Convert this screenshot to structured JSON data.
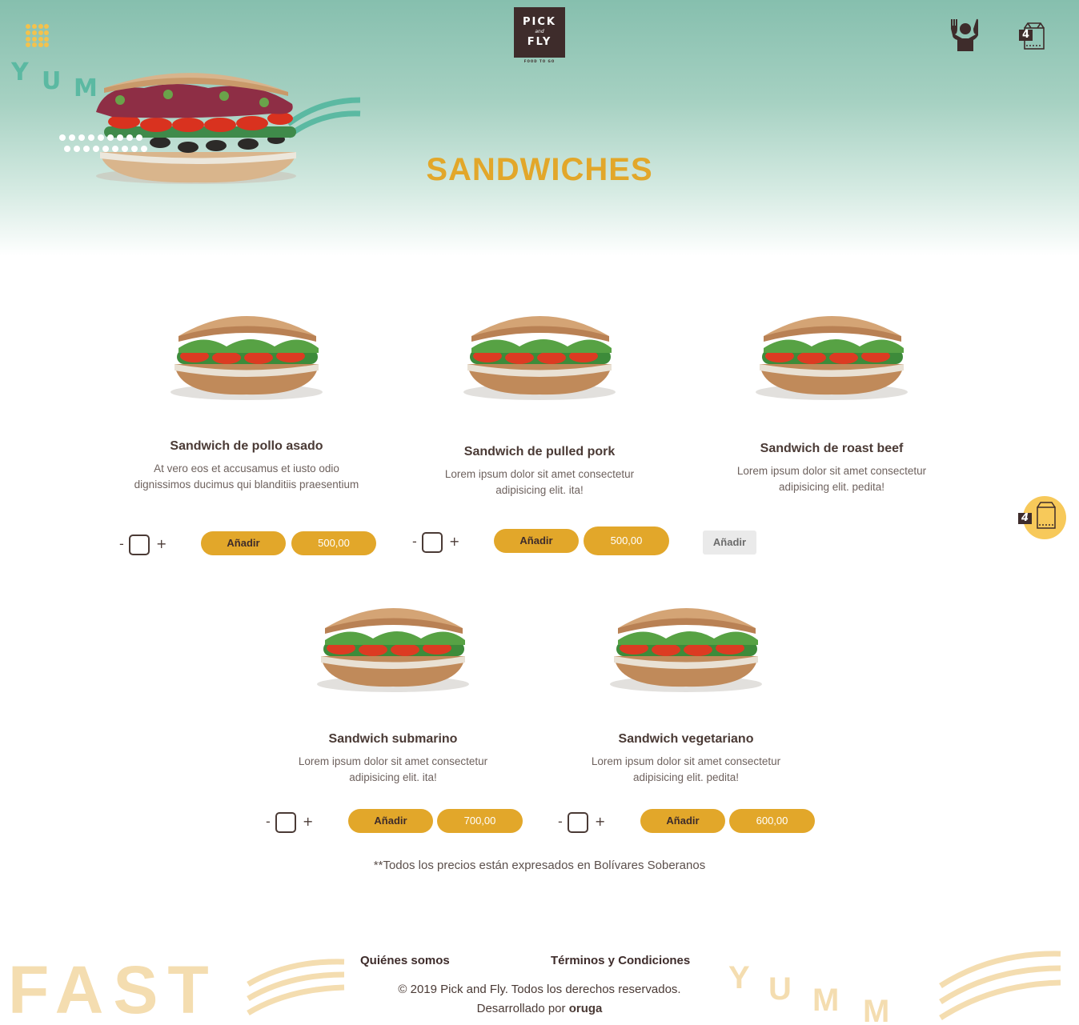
{
  "header": {
    "logo": {
      "line1": "PICK",
      "line2": "and",
      "line3": "FLY",
      "tagline": "FOOD TO GO"
    },
    "menu_icon": "grid-menu-icon",
    "user_icon": "user-icon",
    "cart_icon": "cart-bag-icon",
    "cart_count": "4",
    "hero_letters": [
      "Y",
      "U",
      "M"
    ]
  },
  "page_title": "SANDWICHES",
  "products": [
    {
      "name": "Sandwich de pollo asado",
      "description": "At vero eos et accusamus et iusto odio dignissimos ducimus qui blanditiis praesentium",
      "minus": "-",
      "plus": "+",
      "add_label": "Añadir",
      "price": "500,00"
    },
    {
      "name": "Sandwich de pulled pork",
      "description": "Lorem ipsum dolor sit amet consectetur adipisicing elit. ita!",
      "minus": "-",
      "plus": "+",
      "add_label": "Añadir",
      "price": "500,00"
    },
    {
      "name": "Sandwich de roast beef",
      "description": "Lorem ipsum dolor sit amet consectetur adipisicing elit. pedita!",
      "add_label": "Añadir"
    },
    {
      "name": "Sandwich submarino",
      "description": "Lorem ipsum dolor sit amet consectetur adipisicing elit. ita!",
      "minus": "-",
      "plus": "+",
      "add_label": "Añadir",
      "price": "700,00"
    },
    {
      "name": "Sandwich vegetariano",
      "description": "Lorem ipsum dolor sit amet consectetur adipisicing elit. pedita!",
      "minus": "-",
      "plus": "+",
      "add_label": "Añadir",
      "price": "600,00"
    }
  ],
  "floating_cart": {
    "count": "4",
    "icon": "cart-bag-icon"
  },
  "price_note": "**Todos los precios están expresados en Bolívares Soberanos",
  "footer": {
    "decor_word": "FAST",
    "decor_letters": [
      "Y",
      "U",
      "M",
      "M"
    ],
    "links": [
      "Quiénes somos",
      "Términos y Condiciones"
    ],
    "copyright": "© 2019 Pick and Fly. Todos los derechos reservados.",
    "developed_by": "Desarrollado por",
    "developer": "oruga"
  },
  "colors": {
    "accent": "#e2a72a",
    "dark": "#3e2c2b",
    "mint": "#86bfae",
    "decor": "#f4ddb0"
  }
}
